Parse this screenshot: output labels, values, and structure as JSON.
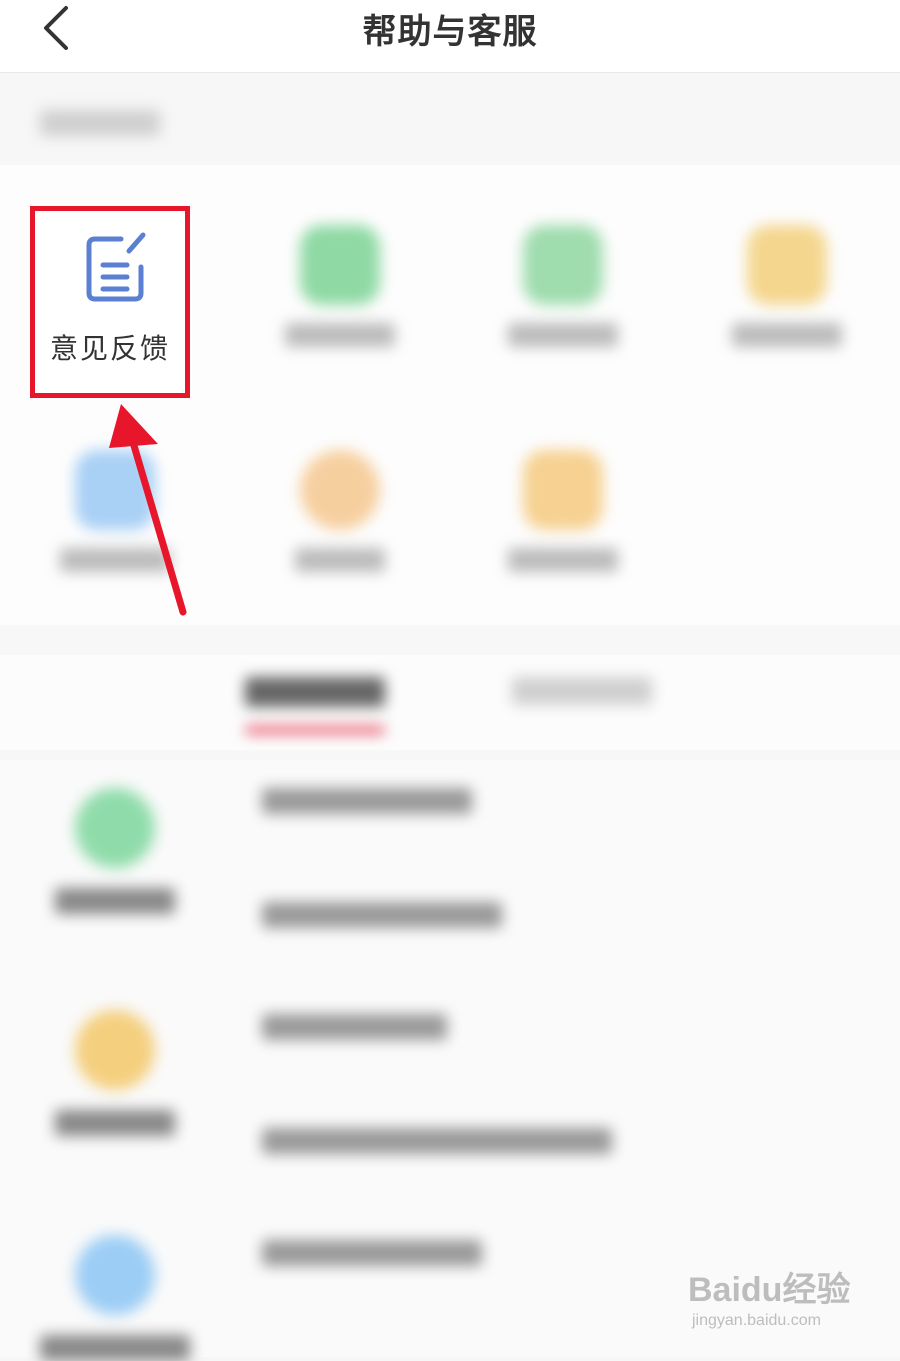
{
  "header": {
    "title": "帮助与客服"
  },
  "services": {
    "feedback_label": "意见反馈",
    "colors": {
      "highlight_border": "#e8162a",
      "feedback_icon": "#5b7fd1"
    }
  },
  "annotation": {
    "arrow_color": "#e8162a"
  },
  "watermark": {
    "brand": "Baidu经验",
    "url": "jingyan.baidu.com"
  }
}
